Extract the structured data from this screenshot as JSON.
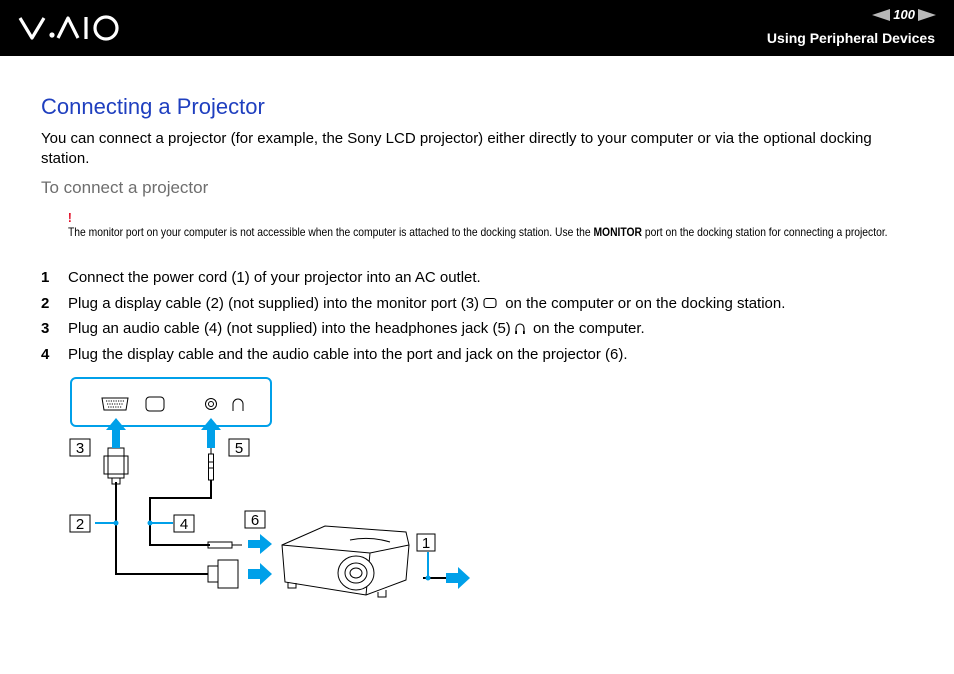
{
  "header": {
    "brand": "VAIO",
    "page_number": "100",
    "section_title": "Using Peripheral Devices"
  },
  "page": {
    "title": "Connecting a Projector",
    "intro": "You can connect a projector (for example, the Sony LCD projector) either directly to your computer or via the optional docking station.",
    "subtitle": "To connect a projector",
    "note": {
      "mark": "!",
      "text_before": "The monitor port on your computer is not accessible when the computer is attached to the docking station. Use the ",
      "bold": "MONITOR",
      "text_after": " port on the docking station for connecting a projector."
    },
    "steps": [
      {
        "num": "1",
        "text": "Connect the power cord (1) of your projector into an AC outlet.",
        "icon": ""
      },
      {
        "num": "2",
        "text_before": "Plug a display cable (2) (not supplied) into the monitor port (3) ",
        "icon": "monitor-port-icon",
        "text_after": " on the computer or on the docking station."
      },
      {
        "num": "3",
        "text_before": "Plug an audio cable (4) (not supplied) into the headphones jack (5) ",
        "icon": "headphones-icon",
        "text_after": " on the computer."
      },
      {
        "num": "4",
        "text": "Plug the display cable and the audio cable into the port and jack on the projector (6)."
      }
    ]
  },
  "diagram": {
    "callouts": [
      "1",
      "2",
      "3",
      "4",
      "5",
      "6"
    ],
    "accent_color": "#00a0e9"
  }
}
